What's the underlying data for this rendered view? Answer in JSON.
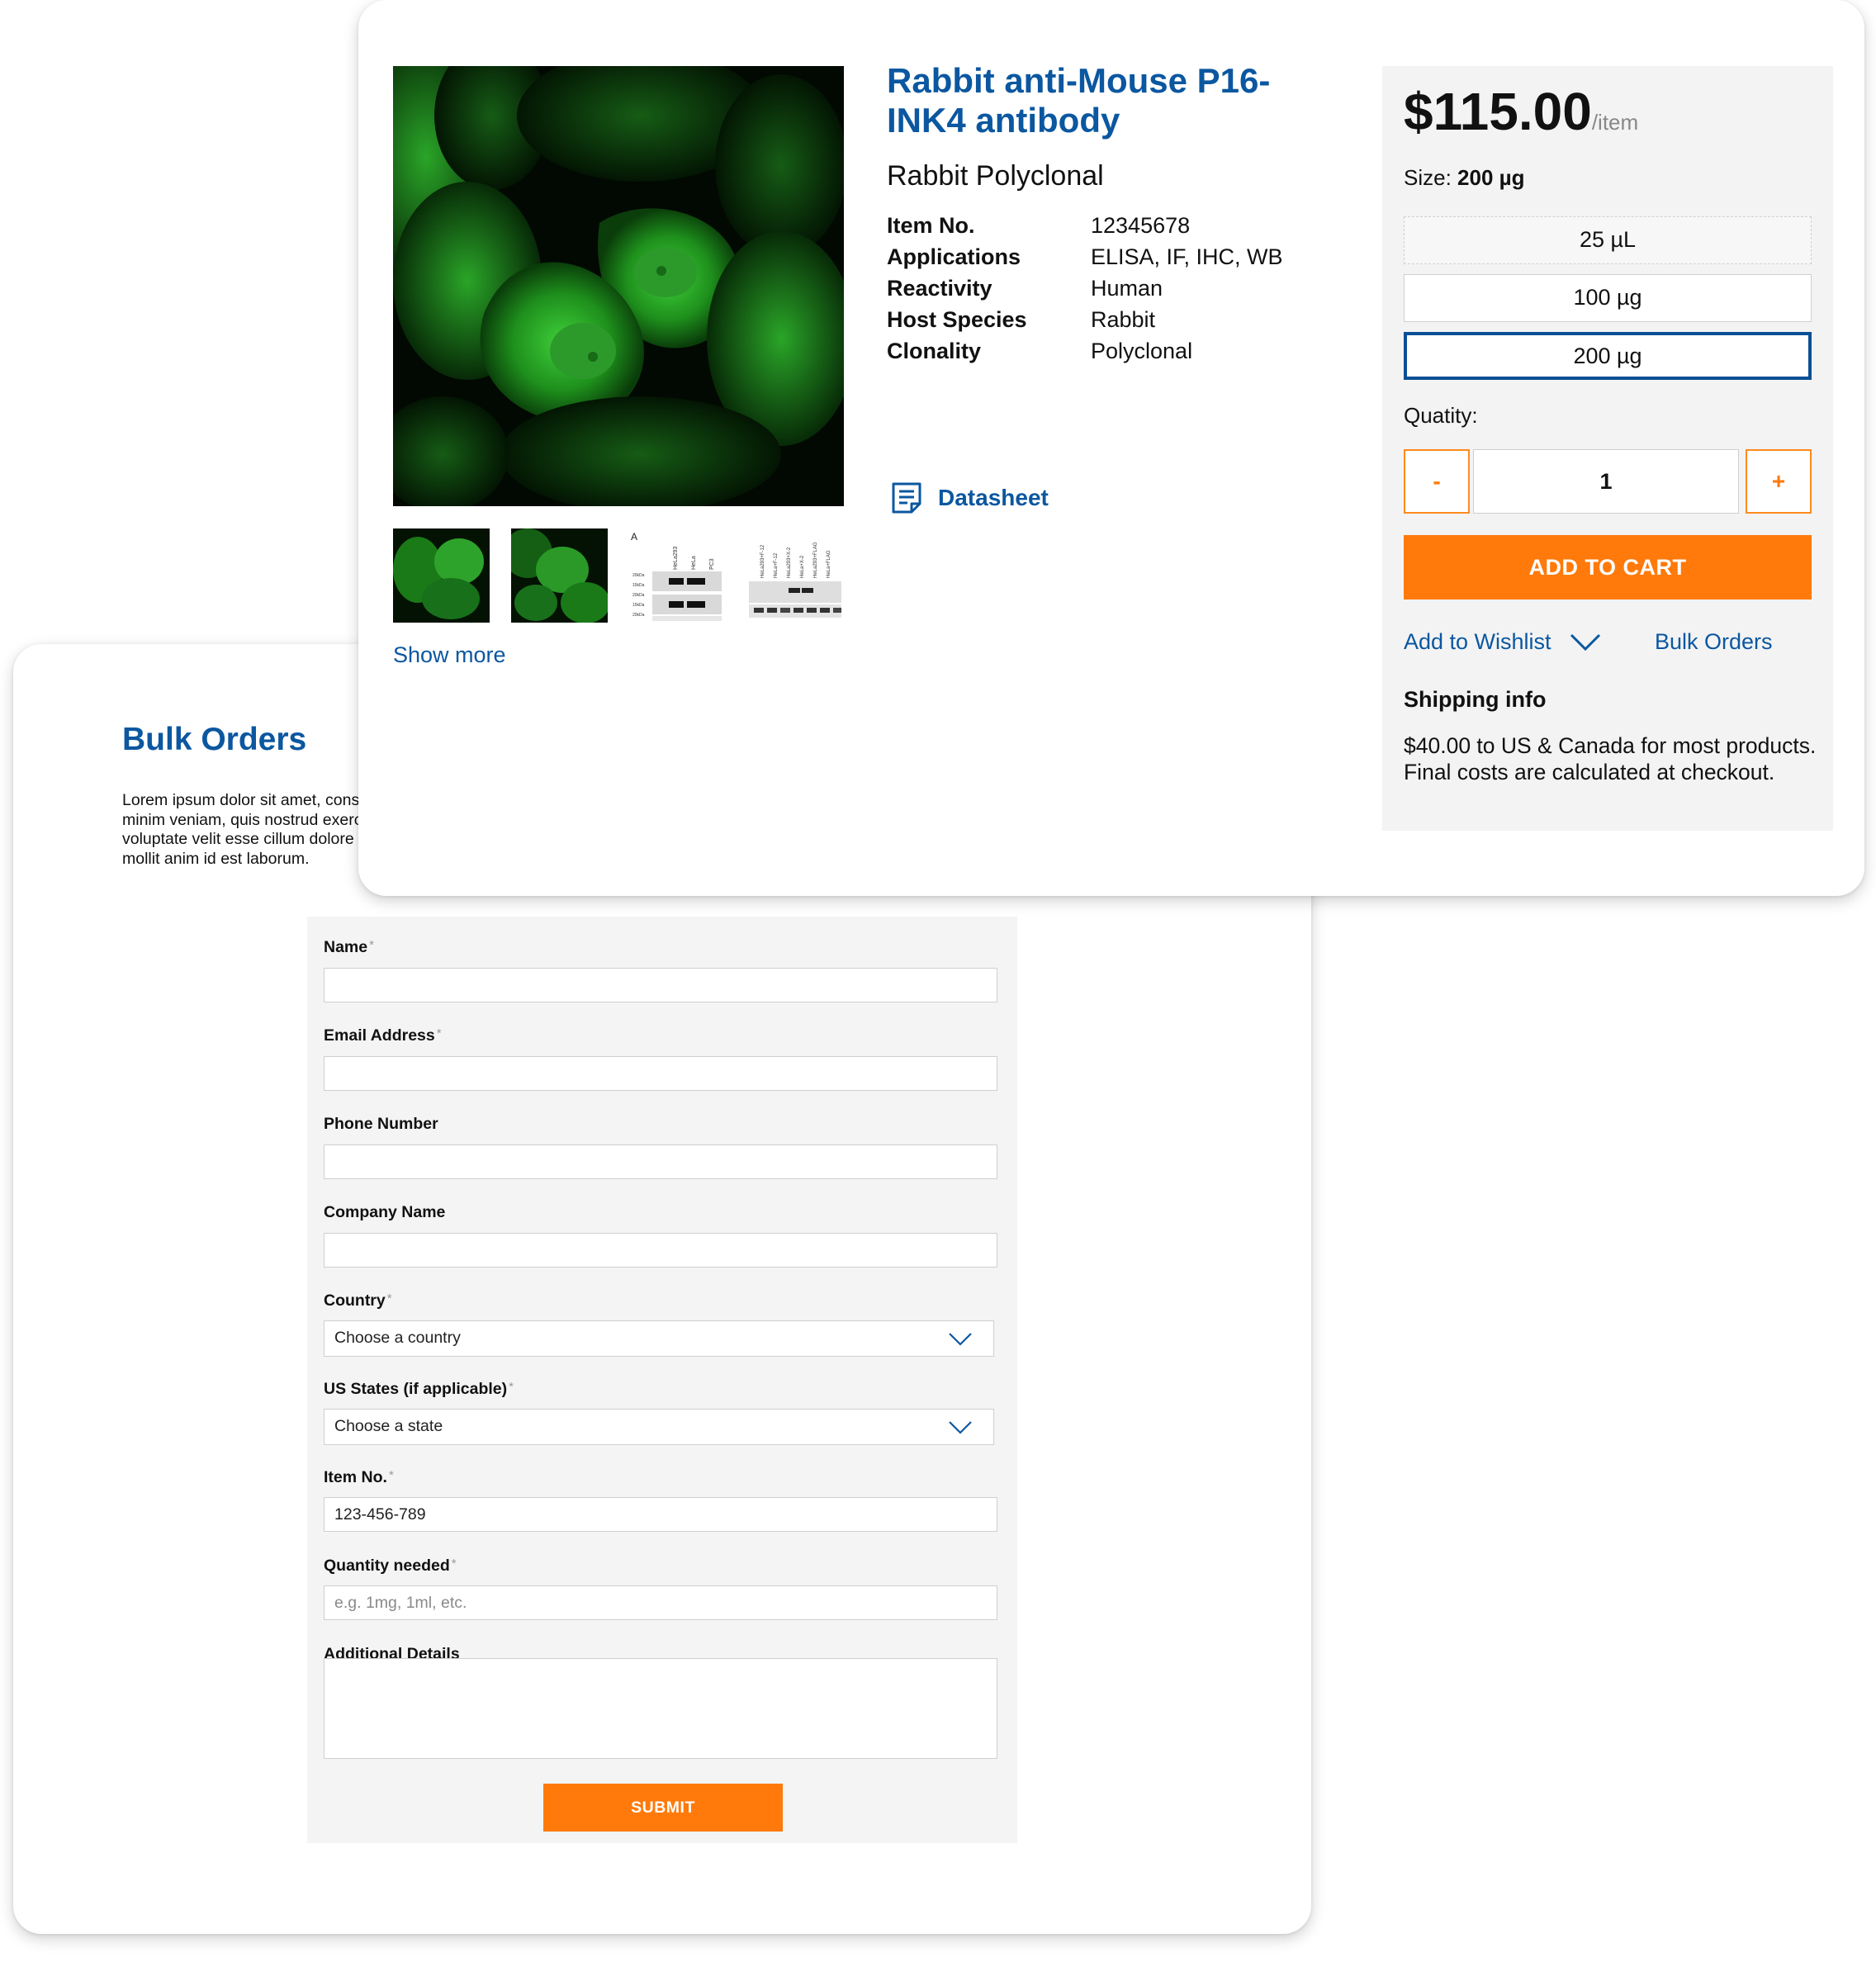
{
  "bulk_orders": {
    "title": "Bulk Orders",
    "description": "Lorem ipsum dolor sit amet, consectetur adipiscing elit, sed do eiusmod tempor incididunt ut labore et dolore magna aliqua. Ut enim ad minim veniam, quis nostrud exercitation ullamco laboris nisi ut aliquip ex ea commodo consequat. Duis aute irure dolor in reprehenderit in voluptate velit esse cillum dolore eu fugiat nulla pariatur. Excepteur sint occaecat cupidatat non proident, sunt in culpa qui officia deserunt mollit anim id est laborum.",
    "form": {
      "name_label": "Name",
      "email_label": "Email Address",
      "phone_label": "Phone Number",
      "company_label": "Company Name",
      "country_label": "Country",
      "country_value": "Choose a country",
      "state_label": "US States (if applicable)",
      "state_value": "Choose a state",
      "item_label": "Item No.",
      "item_value": "123-456-789",
      "quantity_label": "Quantity needed",
      "quantity_placeholder": "e.g. 1mg, 1ml, etc.",
      "details_label": "Additional Details",
      "required_mark": "*",
      "submit_label": "SUBMIT"
    }
  },
  "product": {
    "title": "Rabbit anti-Mouse P16-INK4 antibody",
    "subtitle": "Rabbit Polyclonal",
    "specs": [
      {
        "key": "Item No.",
        "value": "12345678"
      },
      {
        "key": "Applications",
        "value": "ELISA, IF, IHC, WB"
      },
      {
        "key": "Reactivity",
        "value": "Human"
      },
      {
        "key": "Host Species",
        "value": "Rabbit"
      },
      {
        "key": "Clonality",
        "value": "Polyclonal"
      }
    ],
    "datasheet_label": "Datasheet",
    "show_more_label": "Show more",
    "thumbnails": {
      "blot1_panel_letter": "A",
      "blot1_lanes": [
        "HeLa293",
        "HeLa",
        "PC3"
      ],
      "blot1_markers": [
        "20kDa",
        "15kDa",
        "20kDa",
        "15kDa",
        "20kDa"
      ],
      "blot2_lanes": [
        "HeLa293+F-12",
        "HeLa+F-12",
        "HeLa293+X-2",
        "HeLa+X-2",
        "HeLa293+FLAG",
        "HeLa+FLAG"
      ]
    }
  },
  "purchase": {
    "price": "$115.00",
    "price_unit": "/item",
    "size_prefix": "Size:",
    "size_selected": "200 µg",
    "size_options": [
      "25 µL",
      "100 µg",
      "200 µg"
    ],
    "quantity_label": "Quatity:",
    "quantity_value": "1",
    "minus_label": "-",
    "plus_label": "+",
    "add_to_cart_label": "ADD TO CART",
    "wishlist_label": "Add to Wishlist",
    "bulk_orders_label": "Bulk Orders",
    "shipping_title": "Shipping info",
    "shipping_text": "$40.00 to US & Canada for most products. Final costs are calculated at checkout."
  },
  "colors": {
    "brand_blue": "#0b57a0",
    "accent_orange": "#ff7a0a",
    "selected_border": "#0b4f94",
    "panel_gray": "#f3f3f3"
  }
}
